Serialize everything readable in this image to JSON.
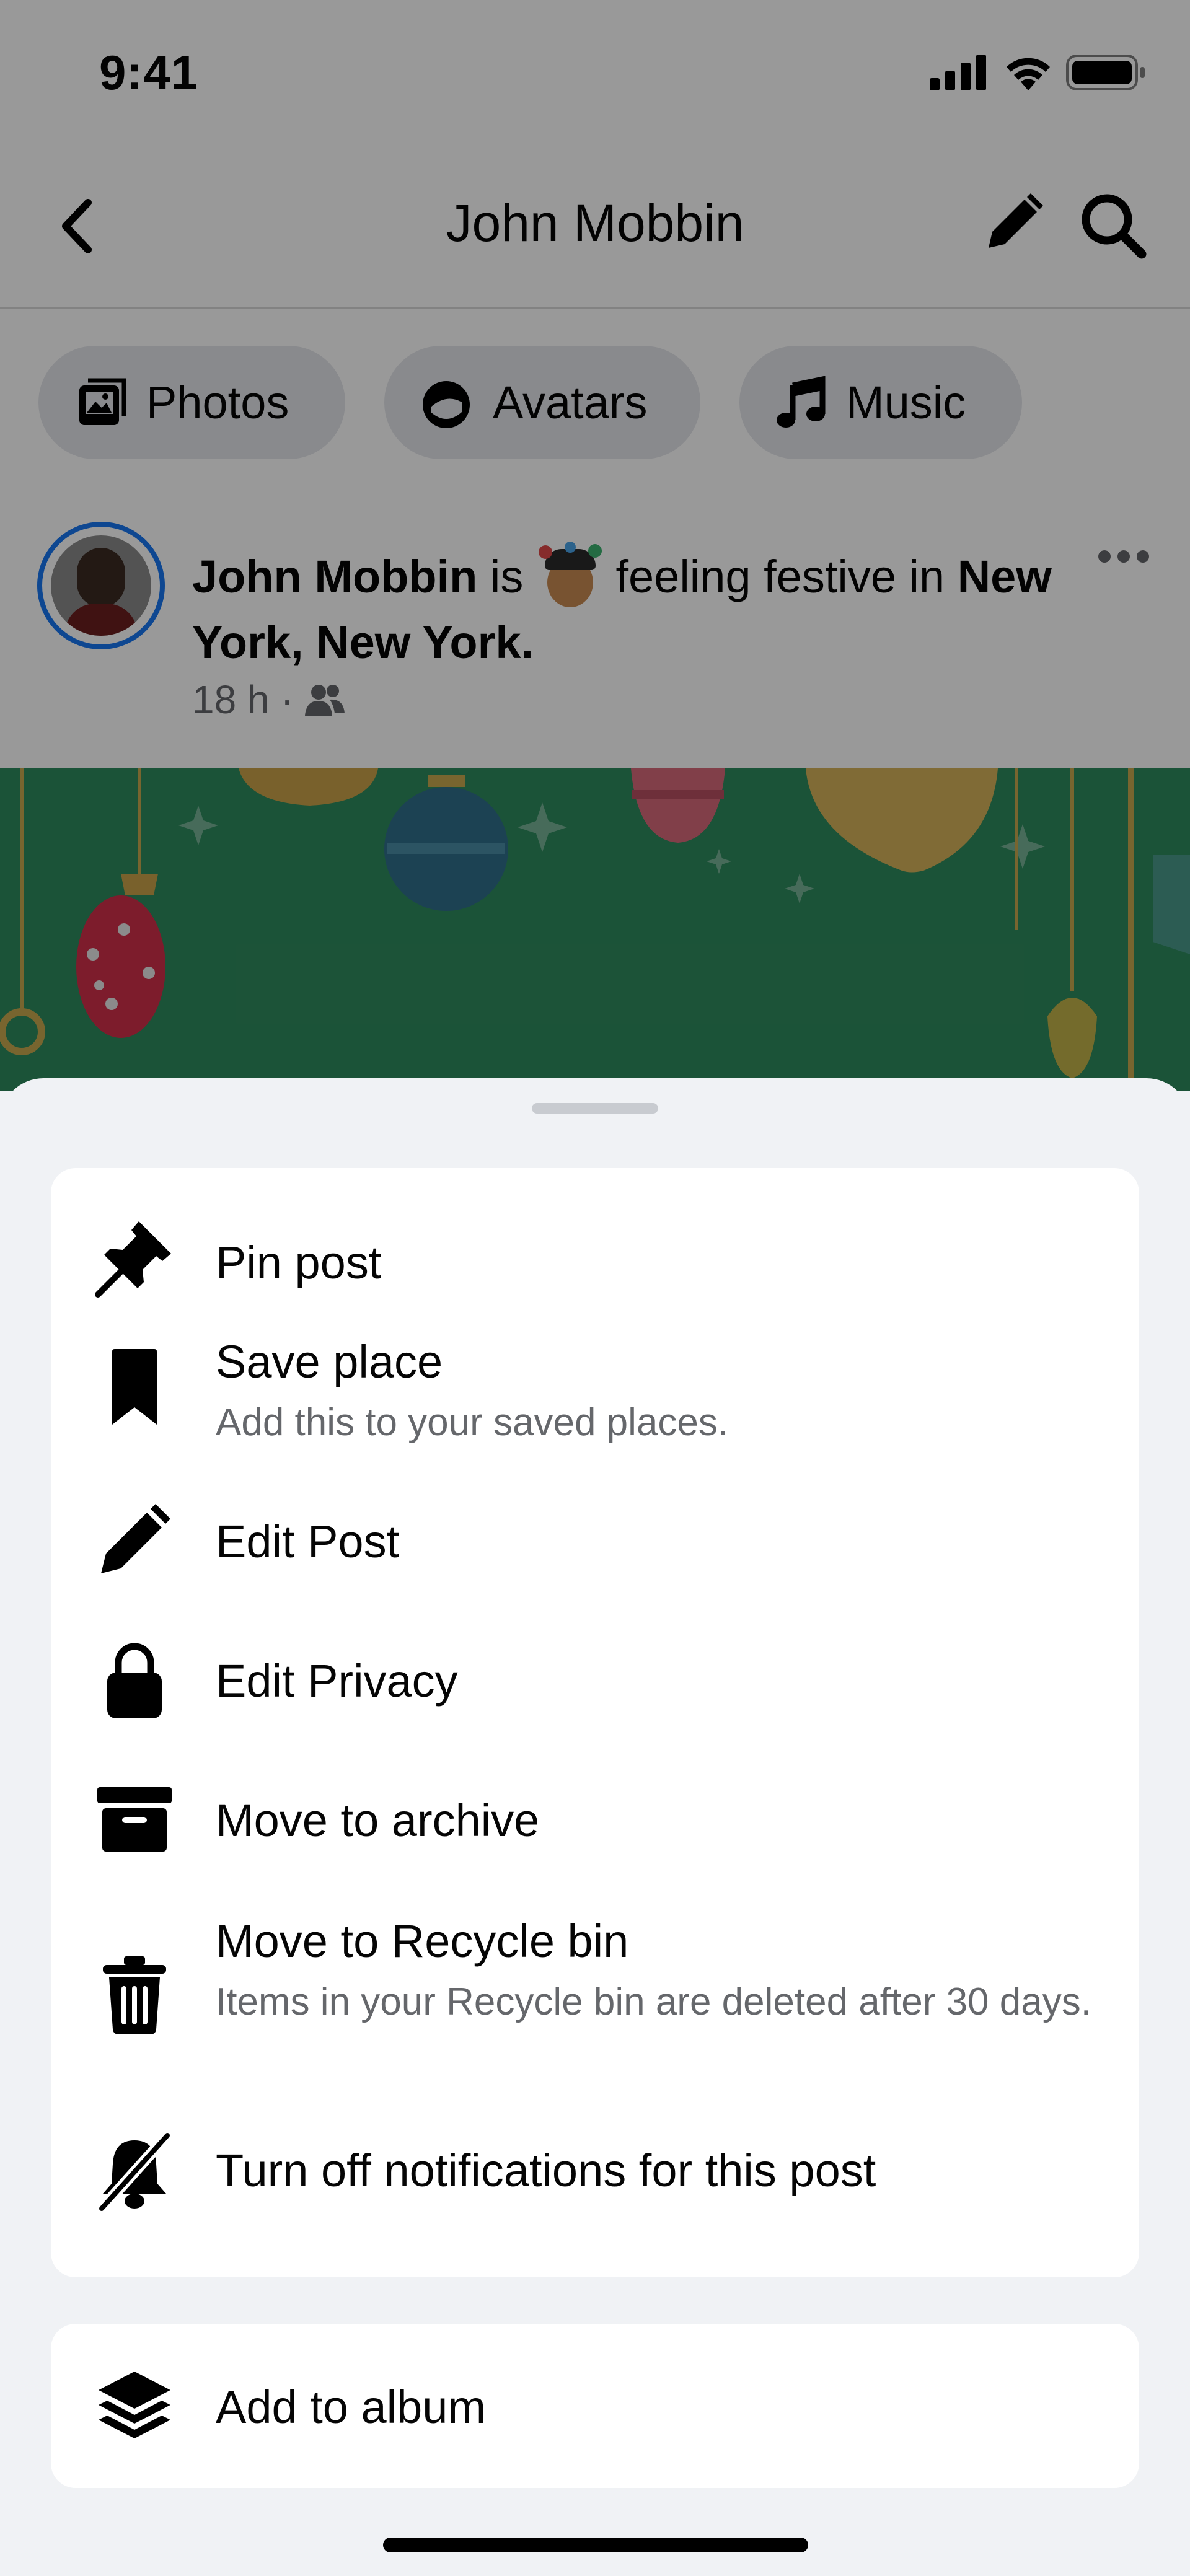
{
  "status_bar": {
    "time": "9:41"
  },
  "nav": {
    "title": "John Mobbin",
    "icons": [
      "back-chevron-icon",
      "edit-pencil-icon",
      "search-icon"
    ]
  },
  "chips": [
    {
      "label": "Photos",
      "icon": "photos-icon"
    },
    {
      "label": "Avatars",
      "icon": "avatar-icon"
    },
    {
      "label": "Music",
      "icon": "music-note-icon"
    }
  ],
  "post": {
    "author": "John Mobbin",
    "verb": "is",
    "feeling_emoji": "festive-avatar-emoji",
    "feeling": "feeling festive in",
    "location": "New York, New York.",
    "time": "18 h",
    "separator": "·",
    "audience_icon": "friends-icon"
  },
  "sheet": {
    "items": [
      {
        "title": "Pin post",
        "subtitle": "",
        "icon": "pin-icon"
      },
      {
        "title": "Save place",
        "subtitle": "Add this to your saved places.",
        "icon": "bookmark-icon"
      },
      {
        "title": "Edit Post",
        "subtitle": "",
        "icon": "pencil-icon"
      },
      {
        "title": "Edit Privacy",
        "subtitle": "",
        "icon": "lock-icon"
      },
      {
        "title": "Move to archive",
        "subtitle": "",
        "icon": "archive-box-icon"
      },
      {
        "title": "Move to Recycle bin",
        "subtitle": "Items in your Recycle bin are deleted after 30 days.",
        "icon": "trash-icon"
      },
      {
        "title": "Turn off notifications for this post",
        "subtitle": "",
        "icon": "bell-off-icon"
      }
    ],
    "album": {
      "title": "Add to album",
      "icon": "layers-icon"
    }
  }
}
